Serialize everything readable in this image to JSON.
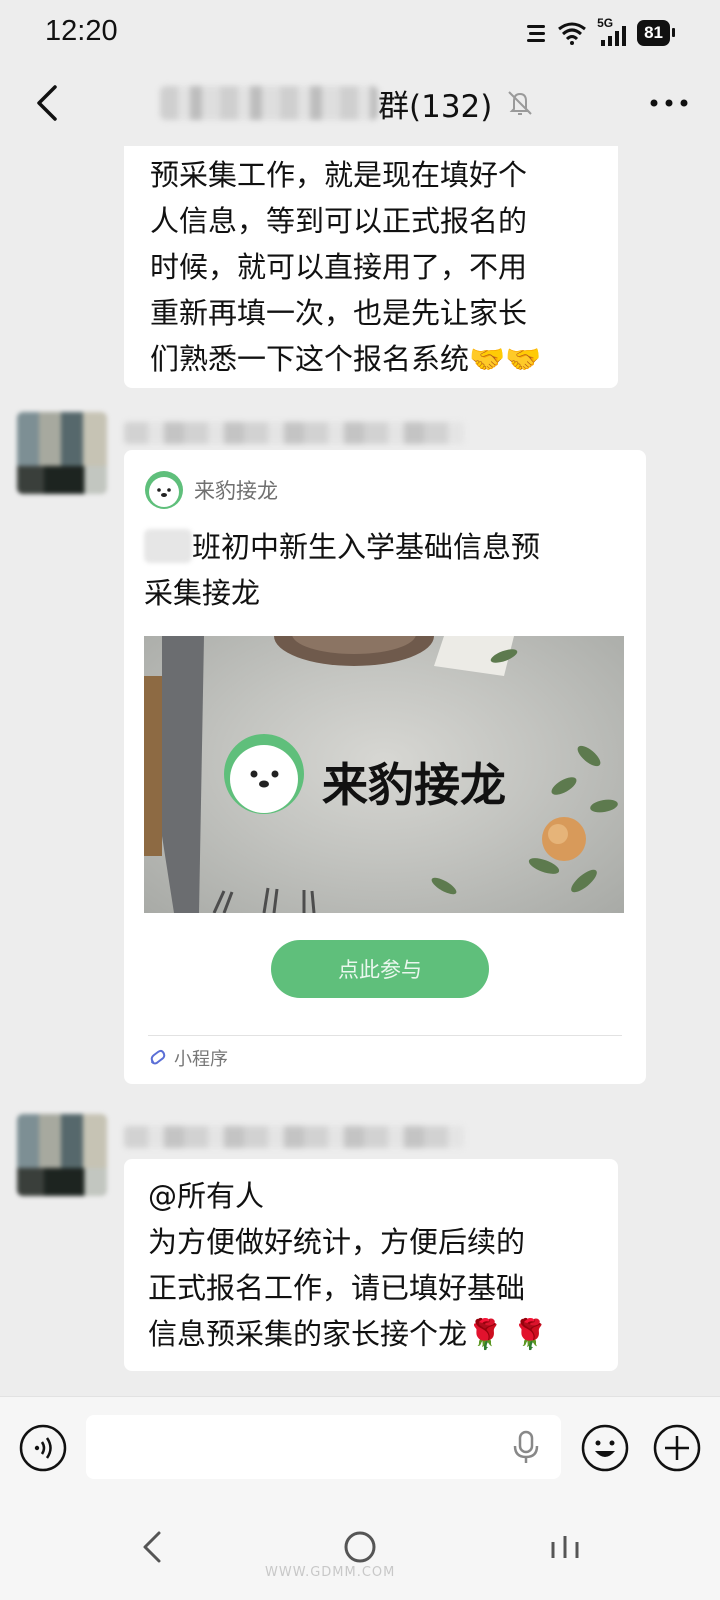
{
  "status_bar": {
    "time": "12:20",
    "network": "5G",
    "battery": "81"
  },
  "nav": {
    "title": "群(132)"
  },
  "messages": {
    "m1": {
      "lines": [
        "预采集工作，就是现在填好个",
        "人信息，等到可以正式报名的",
        "时候，就可以直接用了，不用",
        "重新再填一次，也是先让家长",
        "们熟悉一下这个报名系统🤝🤝"
      ]
    },
    "card": {
      "app_name": "来豹接龙",
      "title_line1": "班初中新生入学基础信息预",
      "title_line2": "采集接龙",
      "banner_text": "来豹接龙",
      "button_label": "点此参与",
      "footer_label": "小程序"
    },
    "m3": {
      "lines": [
        "@所有人",
        "为方便做好统计，方便后续的",
        "正式报名工作，请已填好基础",
        "信息预采集的家长接个龙🌹 🌹"
      ]
    }
  },
  "colors": {
    "accent_green": "#5fbf7b",
    "background": "#ededed",
    "bubble": "#ffffff"
  },
  "icons": {
    "back": "chevron-left-icon",
    "mute": "bell-off-icon",
    "more": "more-dots-icon",
    "voice": "voice-icon",
    "mic": "mic-icon",
    "emoji": "emoji-icon",
    "plus": "plus-icon"
  },
  "watermark": "WWW.GDMM.COM"
}
